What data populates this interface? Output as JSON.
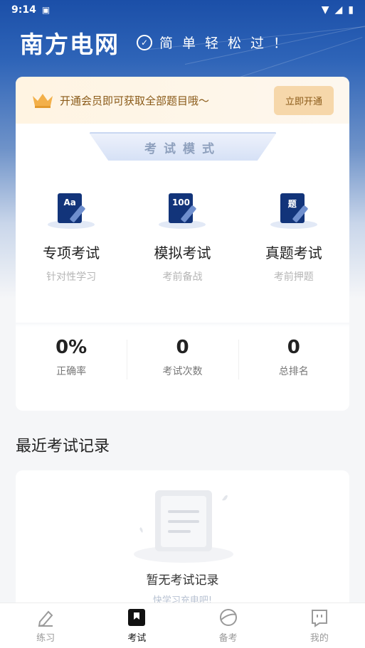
{
  "status_bar": {
    "time": "9:14"
  },
  "header": {
    "title": "南方电网",
    "slogan": "简单轻松过！"
  },
  "vip_banner": {
    "text": "开通会员即可获取全部题目哦～",
    "button_label": "立即开通"
  },
  "exam_mode": {
    "banner_label": "考试模式",
    "modes": [
      {
        "icon_text": "Aa",
        "name": "专项考试",
        "sub": "针对性学习",
        "icon": "book-aa-icon"
      },
      {
        "icon_text": "100",
        "name": "模拟考试",
        "sub": "考前备战",
        "icon": "book-100-icon"
      },
      {
        "icon_text": "题",
        "name": "真题考试",
        "sub": "考前押题",
        "icon": "book-ti-icon"
      }
    ]
  },
  "stats": [
    {
      "value": "0%",
      "label": "正确率"
    },
    {
      "value": "0",
      "label": "考试次数"
    },
    {
      "value": "0",
      "label": "总排名"
    }
  ],
  "records": {
    "section_title": "最近考试记录",
    "empty_title": "暂无考试记录",
    "empty_sub": "快学习充电吧!"
  },
  "tabbar": [
    {
      "label": "练习",
      "icon": "pencil-icon",
      "active": false
    },
    {
      "label": "考试",
      "icon": "exam-icon",
      "active": true
    },
    {
      "label": "备考",
      "icon": "planet-icon",
      "active": false
    },
    {
      "label": "我的",
      "icon": "profile-icon",
      "active": false
    }
  ],
  "colors": {
    "brand_blue": "#1b4fa8",
    "vip_gold": "#8a5a18",
    "book_navy": "#12347a"
  }
}
